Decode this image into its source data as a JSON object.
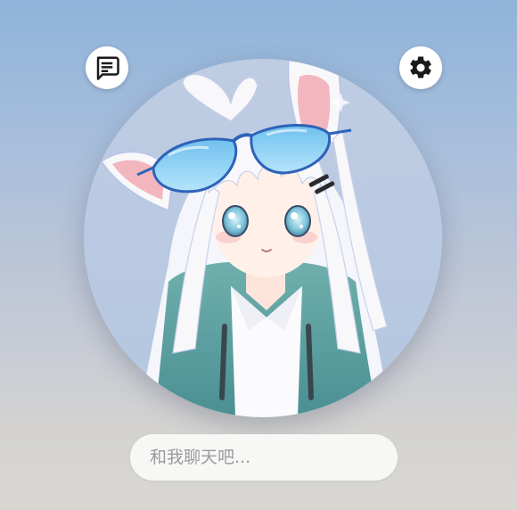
{
  "toolbar": {
    "chat_icon": "chat-message-icon",
    "settings_icon": "gear-icon"
  },
  "avatar": {
    "subject": "anime-girl-cat-ears-sunglasses"
  },
  "chat": {
    "placeholder": "和我聊天吧..."
  },
  "colors": {
    "background_top": "#8fb3da",
    "background_bottom": "#d9d7d2",
    "button_bg": "#ffffff",
    "icon": "#1a1a1a",
    "input_bg": "#f7f7f6",
    "placeholder": "#9a9a9a"
  }
}
